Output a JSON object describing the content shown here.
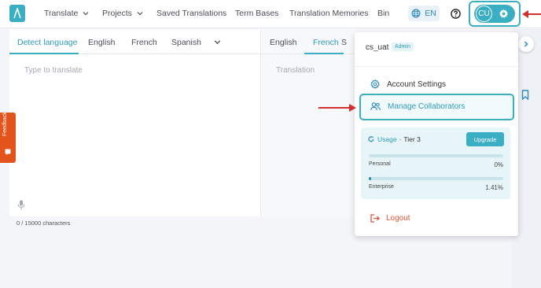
{
  "nav": {
    "translate": "Translate",
    "projects": "Projects",
    "saved_translations": "Saved Translations",
    "term_bases": "Term Bases",
    "translation_memories": "Translation Memories",
    "bin": "Bin",
    "language": "EN",
    "avatar_initials": "CU"
  },
  "source": {
    "tabs": [
      "Detect language",
      "English",
      "French",
      "Spanish"
    ],
    "active_tab": "Detect language",
    "placeholder": "Type to translate",
    "char_count": "0 / 15000 characters"
  },
  "target": {
    "tabs": [
      "English",
      "French",
      "S"
    ],
    "active_tab": "French",
    "placeholder": "Translation"
  },
  "feedback": {
    "label": "Feedback"
  },
  "menu": {
    "username": "cs_uat",
    "role": "Admin",
    "account_settings": "Account Settings",
    "manage_collaborators": "Manage Collaborators",
    "usage_label": "Usage",
    "tier": "Tier 3",
    "upgrade": "Upgrade",
    "personal_label": "Personal",
    "personal_value": "0%",
    "personal_fraction": 0,
    "enterprise_label": "Enterprise",
    "enterprise_value": "1.41%",
    "enterprise_fraction": 0.0141,
    "logout": "Logout"
  },
  "colors": {
    "accent": "#3aaec3",
    "highlight_annotation": "#3aaec3",
    "arrow_annotation": "#d32f2f",
    "feedback": "#e2541c",
    "logout": "#e0553a"
  },
  "icons": [
    "logo-icon",
    "chevron-down-icon",
    "globe-icon",
    "help-icon",
    "gear-icon",
    "microphone-icon",
    "users-icon",
    "refresh-icon",
    "logout-icon",
    "bookmark-icon",
    "chevron-right-icon",
    "feedback-icon"
  ]
}
